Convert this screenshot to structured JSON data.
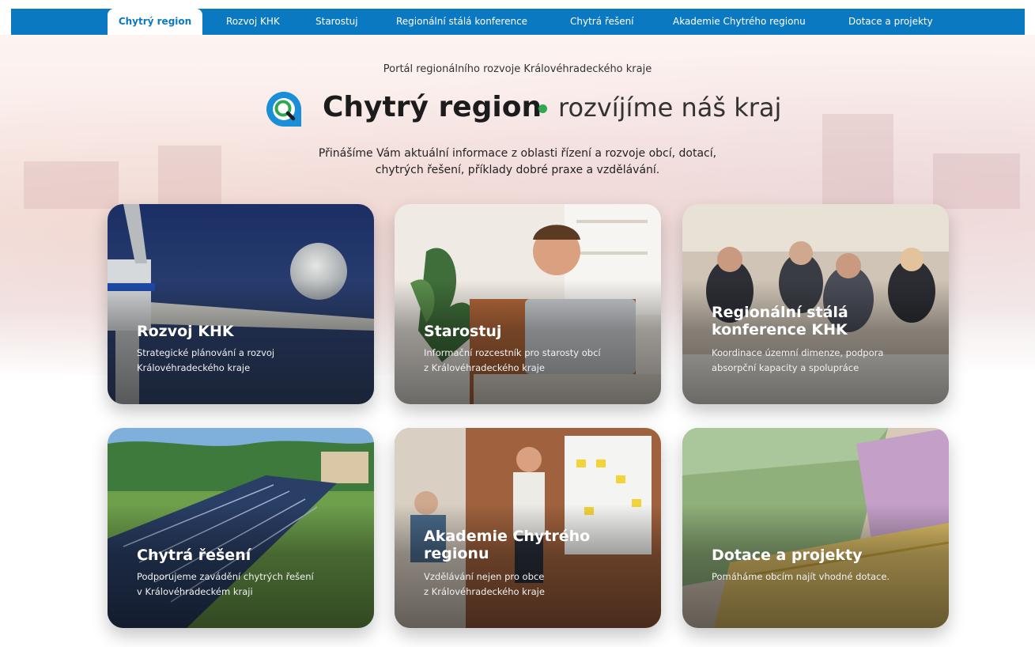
{
  "nav": {
    "items": [
      {
        "label": "Chytrý region",
        "active": true
      },
      {
        "label": "Rozvoj KHK"
      },
      {
        "label": "Starostuj"
      },
      {
        "label": "Regionální stálá konference"
      },
      {
        "label": "Chytrá řešení"
      },
      {
        "label": "Akademie Chytrého regionu"
      },
      {
        "label": "Dotace a projekty"
      }
    ]
  },
  "hero": {
    "subtitle": "Portál regionálního rozvoje Královéhradeckého kraje",
    "brand": "Chytrý region",
    "tagline": "rozvíjíme náš kraj",
    "intro_line1": "Přinášíme Vám aktuální informace z oblasti řízení a rozvoje obcí, dotací,",
    "intro_line2": "chytrých řešení, příklady dobré praxe a vzdělávání."
  },
  "cards": [
    {
      "title_line1": "Rozvoj KHK",
      "desc_line1": "Strategické plánování a rozvoj",
      "desc_line2": "Královéhradeckého kraje",
      "image": "wind-turbine-moon"
    },
    {
      "title_line1": "Starostuj",
      "desc_line1": "Informační rozcestník pro starosty obcí",
      "desc_line2": "z Královéhradeckého kraje",
      "image": "man-with-laptop"
    },
    {
      "title_line1": "Regionální stálá",
      "title_line2": "konference KHK",
      "desc_line1": "Koordinace územní dimenze, podpora",
      "desc_line2": "absorpční kapacity a spolupráce",
      "image": "conference-meeting"
    },
    {
      "title_line1": "Chytrá řešení",
      "desc_line1": "Podporujeme zavádění chytrých řešení",
      "desc_line2": "v Královéhradeckém kraji",
      "image": "solar-panels"
    },
    {
      "title_line1": "Akademie Chytrého",
      "title_line2": "regionu",
      "desc_line1": "Vzdělávání nejen pro obce",
      "desc_line2": "z Královéhradeckého kraje",
      "image": "workshop-whiteboard"
    },
    {
      "title_line1": "Dotace a projekty",
      "desc_line1": "Pomáháme obcím najít vhodné dotace.",
      "image": "euro-banknotes"
    }
  ],
  "colors": {
    "nav_bg": "#0b78c2",
    "brand_dot": "#2fa84f",
    "logo_blue": "#1a8fd8"
  }
}
